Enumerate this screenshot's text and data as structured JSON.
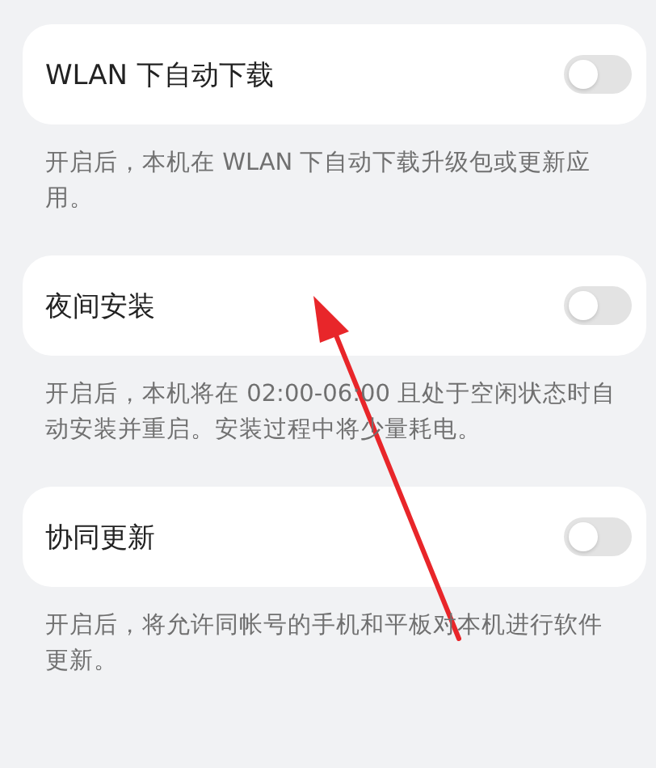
{
  "settings": [
    {
      "title": "WLAN 下自动下载",
      "on": false,
      "description": "开启后，本机在 WLAN 下自动下载升级包或更新应用。"
    },
    {
      "title": "夜间安装",
      "on": false,
      "description": "开启后，本机将在 02:00-06:00 且处于空闲状态时自动安装并重启。安装过程中将少量耗电。"
    },
    {
      "title": "协同更新",
      "on": false,
      "description": "开启后，将允许同帐号的手机和平板对本机进行软件更新。"
    }
  ]
}
